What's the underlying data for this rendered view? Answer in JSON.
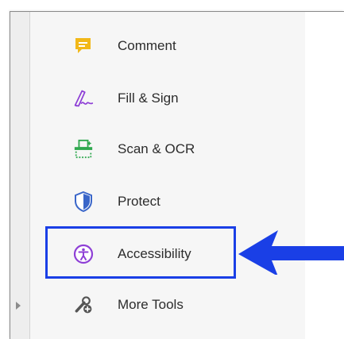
{
  "tools_panel": {
    "items": [
      {
        "label": "Comment",
        "icon": "comment-icon",
        "color": "#f2b818"
      },
      {
        "label": "Fill & Sign",
        "icon": "fill-sign-icon",
        "color": "#8e3fd6"
      },
      {
        "label": "Scan & OCR",
        "icon": "scan-ocr-icon",
        "color": "#2fa84f"
      },
      {
        "label": "Protect",
        "icon": "protect-icon",
        "color": "#3a66c9"
      },
      {
        "label": "Accessibility",
        "icon": "accessibility-icon",
        "color": "#8e3fd6"
      },
      {
        "label": "More Tools",
        "icon": "more-tools-icon",
        "color": "#555555"
      }
    ]
  },
  "annotation": {
    "highlight_color": "#1a3fe6",
    "arrow_color": "#1a3fe6"
  }
}
